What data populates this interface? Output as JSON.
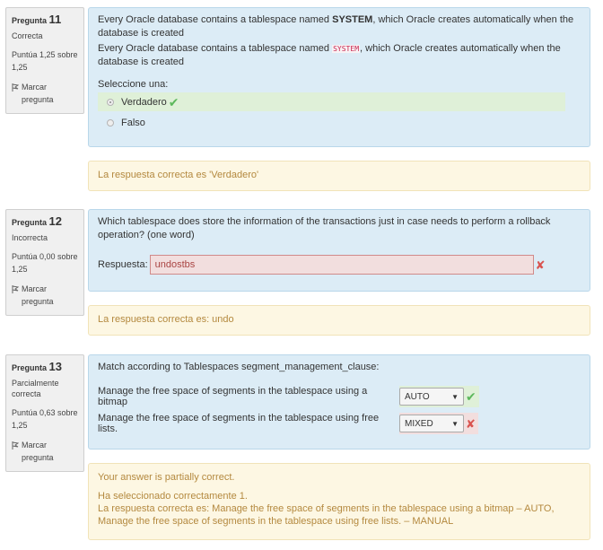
{
  "q11": {
    "label": "Pregunta",
    "number": "11",
    "state": "Correcta",
    "grade": "Puntúa 1,25 sobre 1,25",
    "flag": "Marcar pregunta",
    "text_before": "Every Oracle database contains a tablespace named ",
    "keyword": "SYSTEM",
    "text_after": ", which Oracle creates automatically when the database is created",
    "text2_before": "Every Oracle database contains a tablespace named ",
    "keyword2": "SYSTEM",
    "text2_after": ", which Oracle creates automatically when the database is created",
    "prompt": "Seleccione una:",
    "options": [
      "Verdadero",
      "Falso"
    ],
    "feedback": "La respuesta correcta es 'Verdadero'"
  },
  "q12": {
    "label": "Pregunta",
    "number": "12",
    "state": "Incorrecta",
    "grade": "Puntúa 0,00 sobre 1,25",
    "flag": "Marcar pregunta",
    "text": "Which tablespace does store the information of the transactions just in case needs to perform a rollback operation? (one word)",
    "answer_label": "Respuesta:",
    "answer_value": "undostbs",
    "feedback": "La respuesta correcta es: undo"
  },
  "q13": {
    "label": "Pregunta",
    "number": "13",
    "state": "Parcialmente correcta",
    "grade": "Puntúa 0,63 sobre 1,25",
    "flag": "Marcar pregunta",
    "text": "Match according to Tablespaces segment_management_clause:",
    "rows": [
      {
        "label": "Manage the free space of segments in the tablespace using a bitmap",
        "value": "AUTO"
      },
      {
        "label": "Manage the free space of segments in the tablespace using free lists.",
        "value": "MIXED"
      }
    ],
    "feedback_1": "Your answer is partially correct.",
    "feedback_2": "Ha seleccionado correctamente 1.",
    "feedback_3": "La respuesta correcta es: Manage the free space of segments in the tablespace using a bitmap – AUTO, Manage the free space of segments in the tablespace using free lists. – MANUAL"
  },
  "colors": {
    "content_bg": "#dcecf6",
    "feedback_bg": "#fdf7e3",
    "correct_bg": "#dff0d8",
    "incorrect_bg": "#f2dede",
    "feedback_text": "#b4893f"
  }
}
